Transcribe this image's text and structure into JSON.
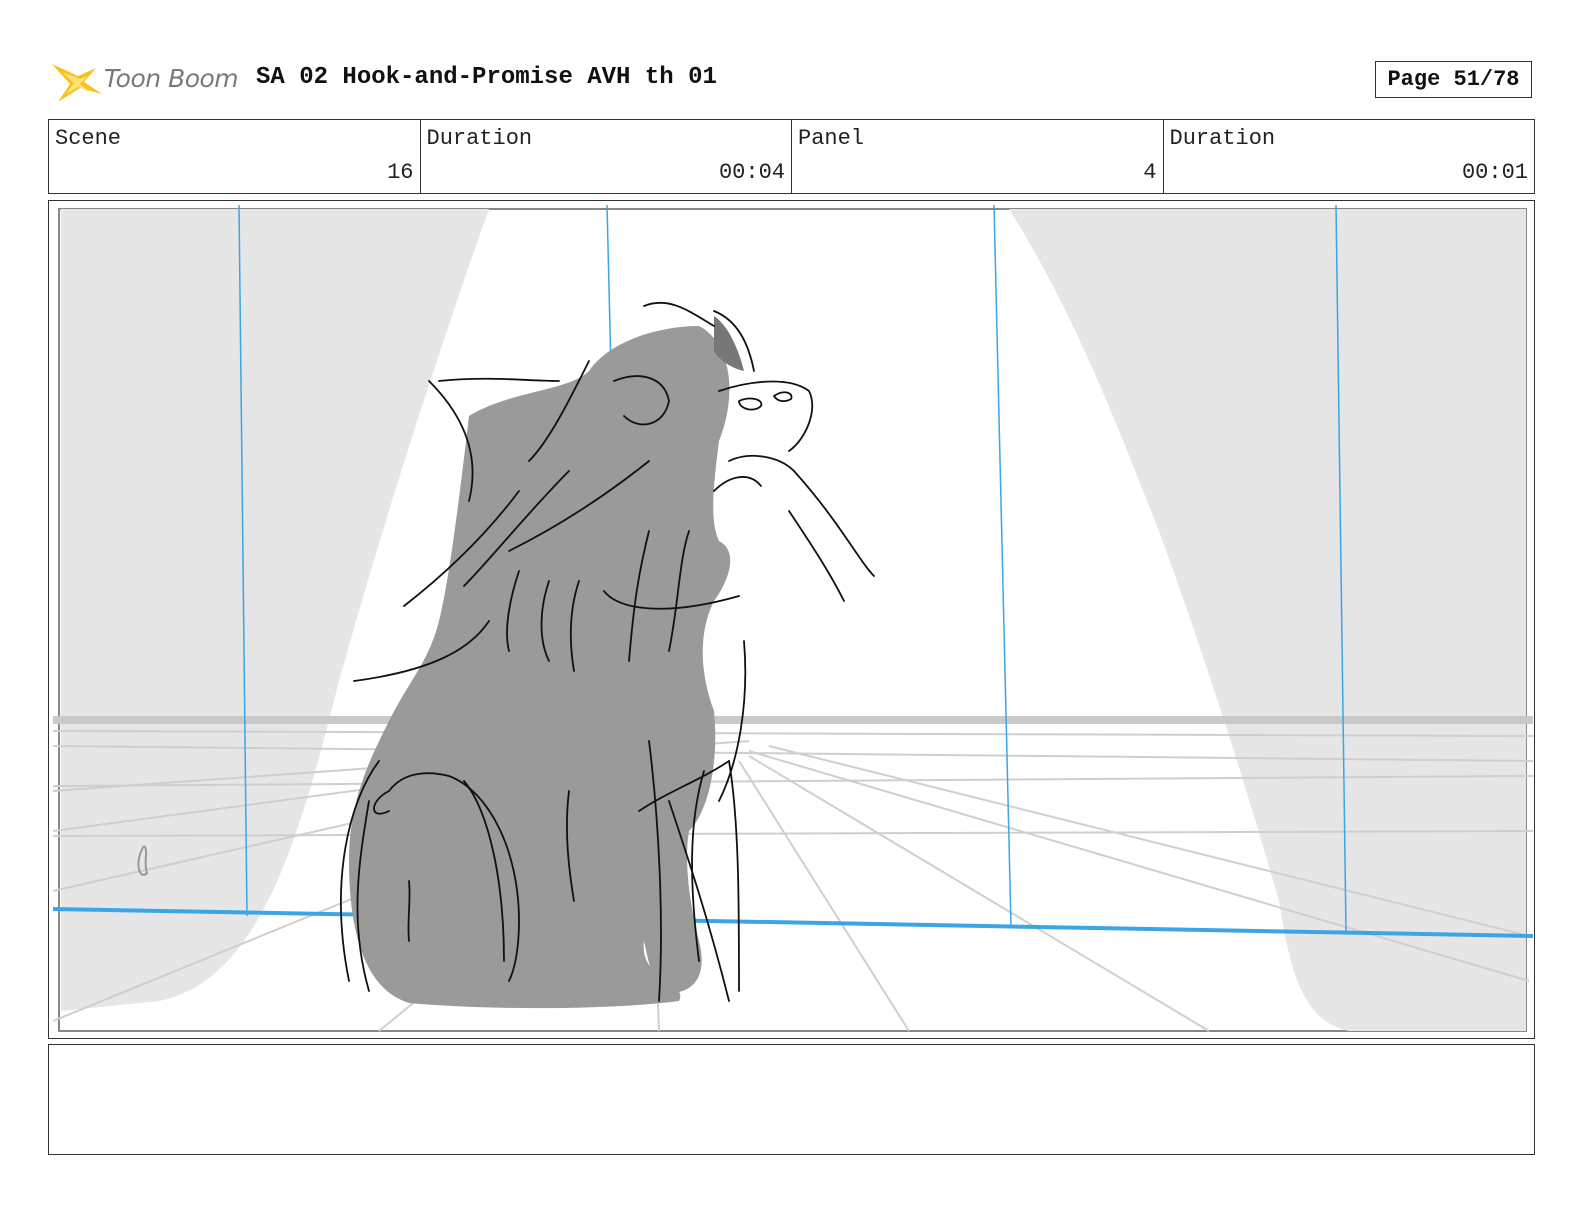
{
  "header": {
    "logo_text": "Toon Boom",
    "title": "SA 02 Hook-and-Promise AVH th 01",
    "page": "Page 51/78"
  },
  "info": {
    "scene_label": "Scene",
    "scene_value": "16",
    "scene_duration_label": "Duration",
    "scene_duration_value": "00:04",
    "panel_label": "Panel",
    "panel_value": "4",
    "panel_duration_label": "Duration",
    "panel_duration_value": "00:01"
  },
  "notes": {
    "text": ""
  },
  "colors": {
    "logo_star": "#f5c518",
    "guide_blue": "#3aa6e6",
    "cat_fill": "#9a9a9a",
    "curtain": "#e5e5e5"
  }
}
